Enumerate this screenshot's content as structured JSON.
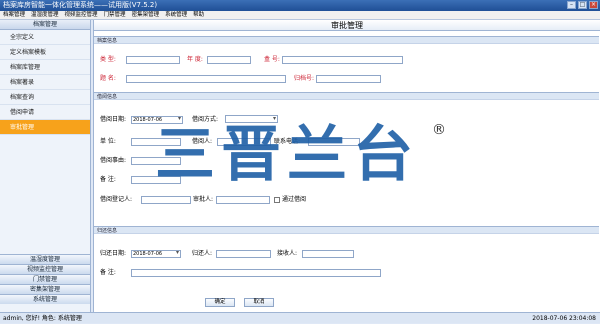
{
  "window": {
    "title": "档案库房智能一体化管理系统——试用版(V7.5.2)"
  },
  "menu": [
    "档案管理",
    "温湿度管理",
    "视频监控管理",
    "门禁管理",
    "密集架管理",
    "系统管理",
    "帮助"
  ],
  "sidebar": {
    "header": "档案管理",
    "items": [
      {
        "label": "全宗定义",
        "active": false
      },
      {
        "label": "定义档案模板",
        "active": false
      },
      {
        "label": "档案库管理",
        "active": false
      },
      {
        "label": "档案著录",
        "active": false
      },
      {
        "label": "档案查询",
        "active": false
      },
      {
        "label": "借阅申请",
        "active": false
      },
      {
        "label": "审批管理",
        "active": true
      }
    ],
    "bottom": [
      "温湿度管理",
      "视频监控管理",
      "门禁管理",
      "密集架管理",
      "系统管理"
    ]
  },
  "main": {
    "title": "审批管理",
    "sections": {
      "archive": "档案信息",
      "borrow": "借阅信息",
      "return": "归还信息"
    },
    "archive": {
      "category_label": "类    型:",
      "year_label": "年  度:",
      "box_label": "盒  号:",
      "title_label": "题    名:",
      "archive_no_label": "归档号:"
    },
    "borrow": {
      "date_label": "借阅日期:",
      "date_value": "2018-07-06",
      "method_label": "借阅方式:",
      "unit_label": "单      位:",
      "borrower_label": "借阅人:",
      "phone_label": "联系电话:",
      "reason_label": "借阅事由:",
      "note_label": "备      注:",
      "registrar_label": "借阅登记人:",
      "approver_label": "审批人:",
      "approve_check": "通过借阅"
    },
    "return": {
      "date_label": "归还日期:",
      "date_value": "2018-07-06",
      "returner_label": "归还人:",
      "receiver_label": "接收人:",
      "note_label": "备      注:"
    },
    "buttons": {
      "ok": "确定",
      "cancel": "取消"
    }
  },
  "watermark": {
    "text": "三晋兰台",
    "reg": "®"
  },
  "status": {
    "user": "admin, 您好!   角色: 系统管理",
    "time": "2018-07-06 23:04:08"
  }
}
